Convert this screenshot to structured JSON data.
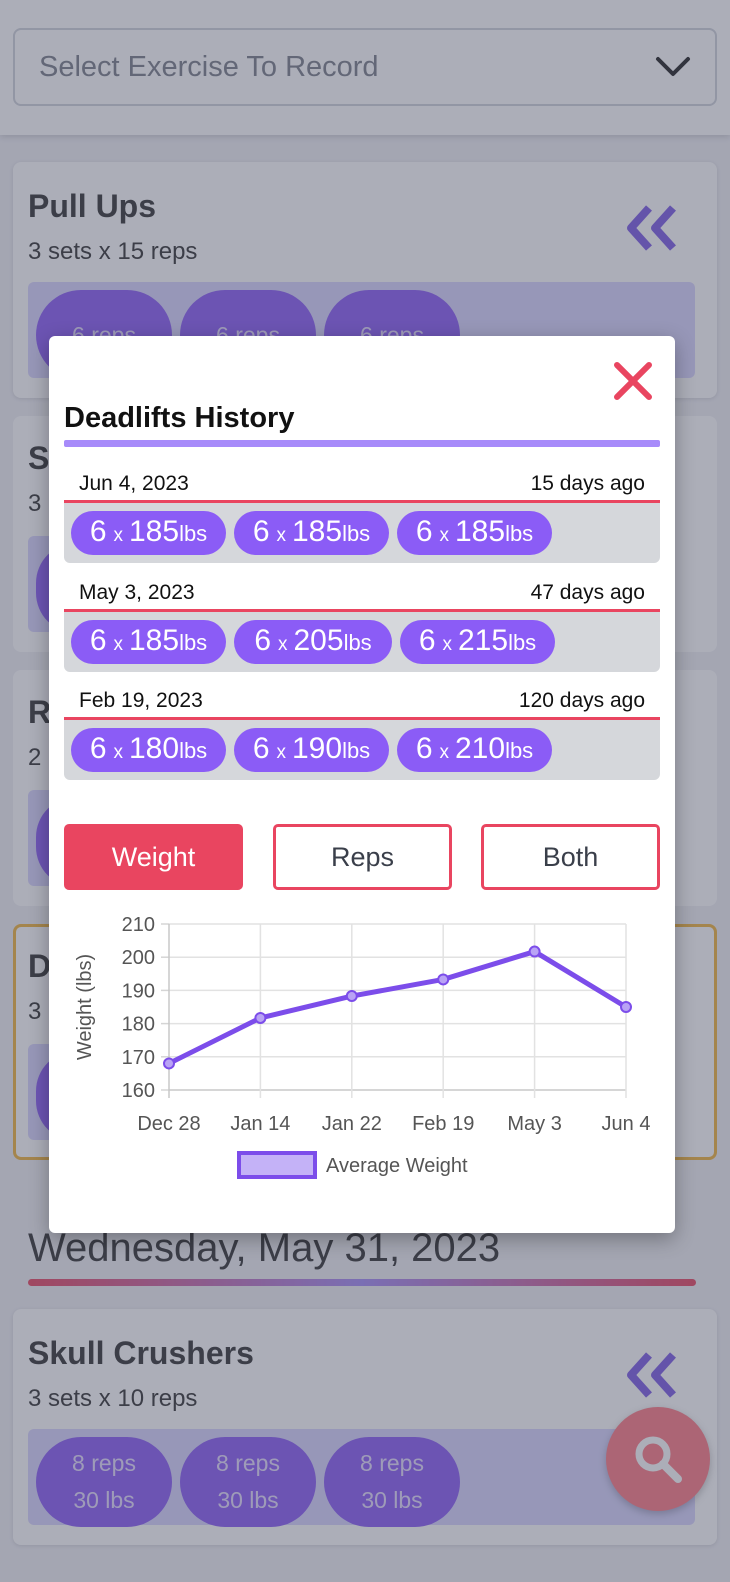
{
  "header": {
    "select_placeholder": "Select Exercise To Record"
  },
  "cards": [
    {
      "title": "Pull Ups",
      "subtitle": "3 sets x 15 reps",
      "pills": [
        {
          "line1": "6 reps",
          "line2": ""
        },
        {
          "line1": "6 reps",
          "line2": ""
        },
        {
          "line1": "6 reps",
          "line2": ""
        }
      ]
    }
  ],
  "edge_cards": [
    {
      "letter": "S",
      "num": "3"
    },
    {
      "letter": "R",
      "num": "2"
    },
    {
      "letter": "D",
      "num": "3"
    }
  ],
  "day_heading": "Wednesday, May 31, 2023",
  "skull_card": {
    "title": "Skull Crushers",
    "subtitle": "3 sets x 10 reps",
    "pills": [
      {
        "line1": "8 reps",
        "line2": "30 lbs"
      },
      {
        "line1": "8 reps",
        "line2": "30 lbs"
      },
      {
        "line1": "8 reps",
        "line2": "30 lbs"
      }
    ]
  },
  "modal": {
    "title": "Deadlifts History",
    "close_icon": "close-x-icon",
    "sessions": [
      {
        "date": "Jun 4, 2023",
        "ago": "15 days ago",
        "sets": [
          {
            "reps": "6",
            "weight": "185",
            "unit": "lbs"
          },
          {
            "reps": "6",
            "weight": "185",
            "unit": "lbs"
          },
          {
            "reps": "6",
            "weight": "185",
            "unit": "lbs"
          }
        ]
      },
      {
        "date": "May 3, 2023",
        "ago": "47 days ago",
        "sets": [
          {
            "reps": "6",
            "weight": "185",
            "unit": "lbs"
          },
          {
            "reps": "6",
            "weight": "205",
            "unit": "lbs"
          },
          {
            "reps": "6",
            "weight": "215",
            "unit": "lbs"
          }
        ]
      },
      {
        "date": "Feb 19, 2023",
        "ago": "120 days ago",
        "sets": [
          {
            "reps": "6",
            "weight": "180",
            "unit": "lbs"
          },
          {
            "reps": "6",
            "weight": "190",
            "unit": "lbs"
          },
          {
            "reps": "6",
            "weight": "210",
            "unit": "lbs"
          }
        ]
      }
    ],
    "x_symbol": "x",
    "modes": [
      "Weight",
      "Reps",
      "Both"
    ],
    "active_mode": "Weight"
  },
  "colors": {
    "accent_purple": "#8b5cf6",
    "accent_red": "#e94560",
    "line_purple": "#7c4dea"
  },
  "chart_data": {
    "type": "line",
    "categories": [
      "Dec 28",
      "Jan 14",
      "Jan 22",
      "Feb 19",
      "May 3",
      "Jun 4"
    ],
    "series": [
      {
        "name": "Average Weight",
        "values": [
          168,
          181.7,
          188.3,
          193.3,
          201.7,
          185
        ]
      }
    ],
    "xlabel": "",
    "ylabel": "Weight (lbs)",
    "ylim": [
      160,
      210
    ],
    "yticks": [
      160,
      170,
      180,
      190,
      200,
      210
    ],
    "grid": true,
    "legend": "bottom"
  }
}
